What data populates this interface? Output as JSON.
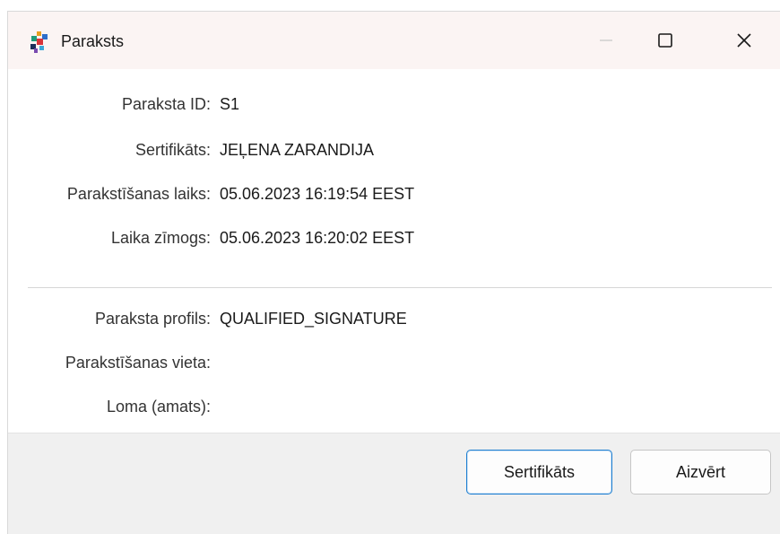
{
  "window": {
    "title": "Paraksts",
    "app_icon": "puzzle-app-icon",
    "controls": {
      "minimize_icon": "minimize-icon",
      "maximize_icon": "maximize-icon",
      "close_icon": "close-icon"
    }
  },
  "details": [
    {
      "label": "Paraksta ID:",
      "value": "S1"
    },
    {
      "label": "Sertifikāts:",
      "value": "JEĻENA ZARANDIJA"
    },
    {
      "label": "Parakstīšanas laiks:",
      "value": "05.06.2023 16:19:54 EEST"
    },
    {
      "label": "Laika zīmogs:",
      "value": "05.06.2023 16:20:02 EEST"
    }
  ],
  "extra_details": [
    {
      "label": "Paraksta profils:",
      "value": "QUALIFIED_SIGNATURE"
    },
    {
      "label": "Parakstīšanas vieta:",
      "value": ""
    },
    {
      "label": "Loma (amats):",
      "value": ""
    }
  ],
  "buttons": {
    "certificate": "Sertifikāts",
    "close": "Aizvērt"
  },
  "colors": {
    "titlebar_bg": "#fbf4f3",
    "footer_bg": "#f0f0f0",
    "focus_border": "#1f7fd1"
  }
}
